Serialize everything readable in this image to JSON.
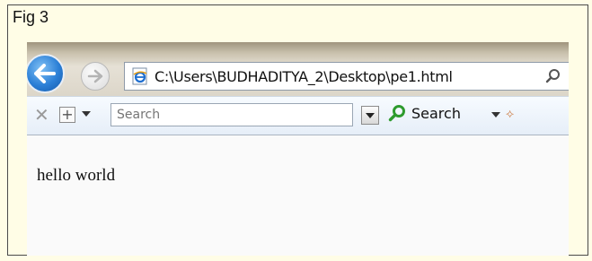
{
  "figure": {
    "label": "Fig 3"
  },
  "browser": {
    "address_bar": {
      "url": "C:\\Users\\BUDHADITYA_2\\Desktop\\pe1.html"
    },
    "toolbar": {
      "search_placeholder": "Search",
      "search_button_label": "Search"
    },
    "page": {
      "body_text": "hello world"
    }
  },
  "icons": {
    "back": "back-arrow-icon",
    "forward": "forward-arrow-icon",
    "page": "ie-page-icon",
    "address_search": "search-icon",
    "close": "close-icon",
    "add": "plus-icon",
    "search": "search-icon",
    "more": "more-icon"
  },
  "colors": {
    "back_button": "#2b7fd6",
    "search_icon": "#2e9b2e",
    "figure_background": "#fffde6"
  }
}
